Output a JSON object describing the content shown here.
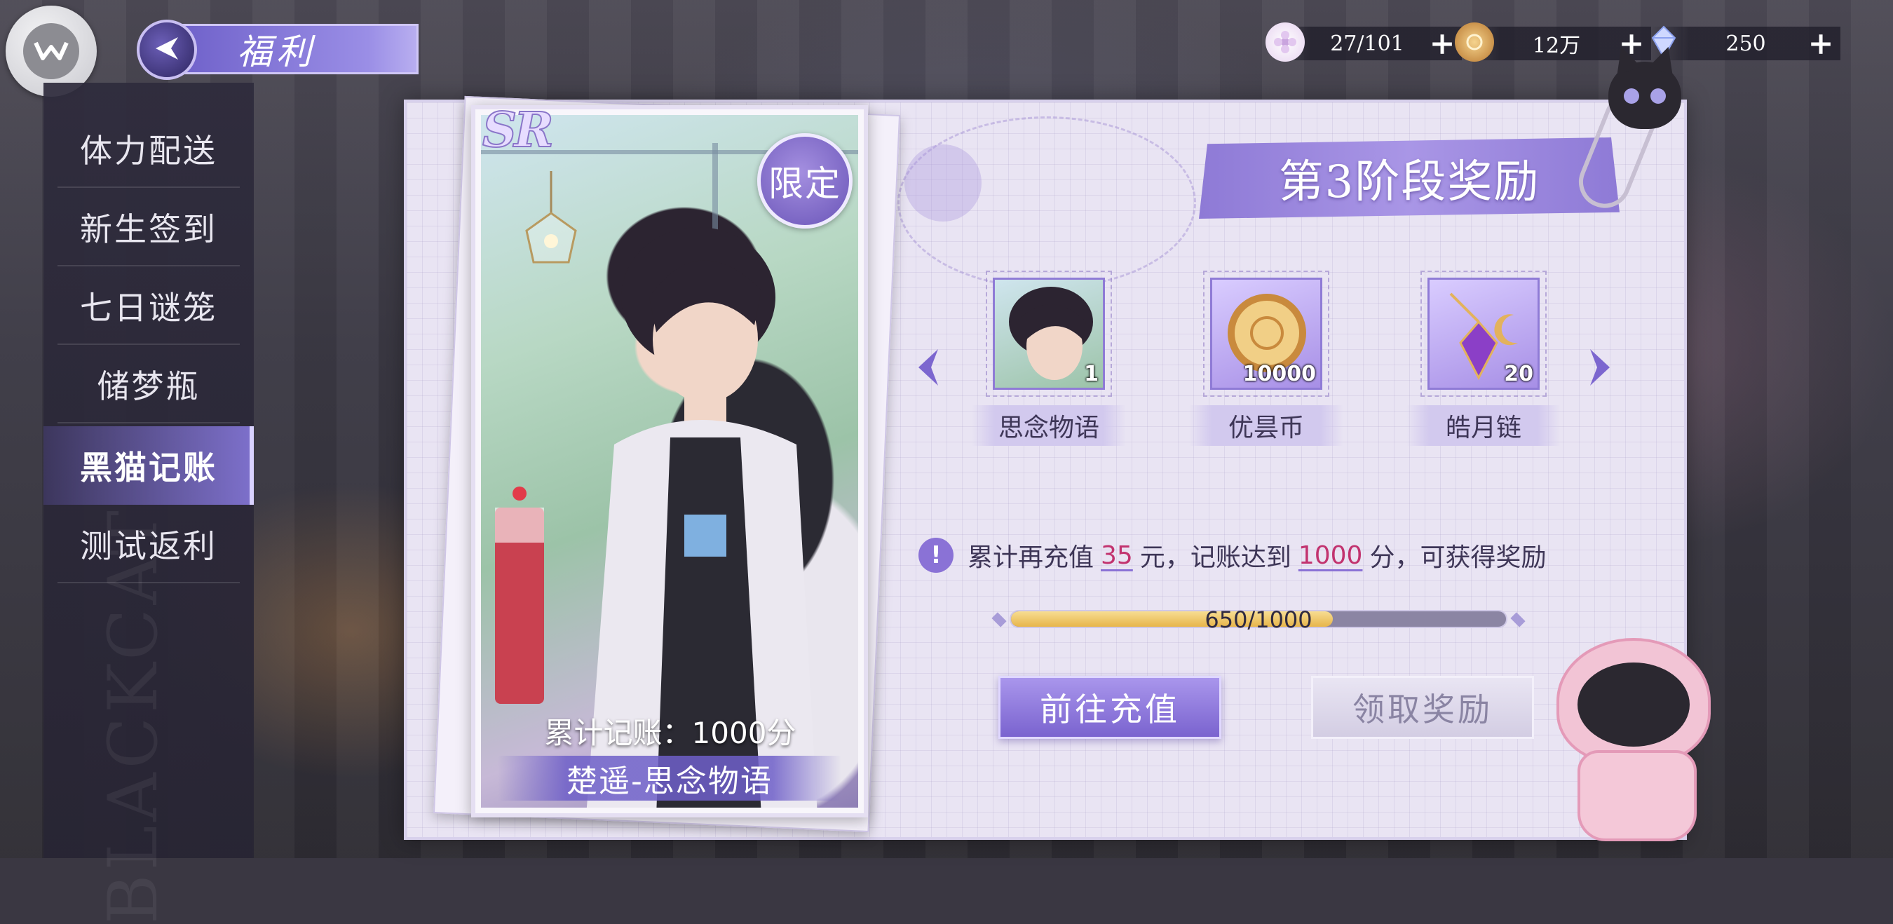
{
  "header": {
    "title": "福利"
  },
  "currencies": [
    {
      "icon": "stamina-flower-icon",
      "value": "27/101"
    },
    {
      "icon": "coin-icon",
      "value": "12万"
    },
    {
      "icon": "crystal-icon",
      "value": "250"
    }
  ],
  "sidebar": {
    "items": [
      {
        "label": "体力配送",
        "active": false
      },
      {
        "label": "新生签到",
        "active": false
      },
      {
        "label": "七日谜笼",
        "active": false
      },
      {
        "label": "储梦瓶",
        "active": false
      },
      {
        "label": "黑猫记账",
        "active": true
      },
      {
        "label": "测试返利",
        "active": false
      }
    ],
    "bg_text": "BLACKCAT"
  },
  "card": {
    "rarity": "SR",
    "limited": "限定",
    "caption": "累计记账：1000分",
    "name": "楚遥-思念物语"
  },
  "stage": {
    "title": "第3阶段奖励"
  },
  "rewards": [
    {
      "label": "思念物语",
      "count": "1",
      "icon": "character-portrait-icon"
    },
    {
      "label": "优昙币",
      "count": "10000",
      "icon": "coin-icon"
    },
    {
      "label": "皓月链",
      "count": "20",
      "icon": "moon-pendant-icon"
    }
  ],
  "requirement": {
    "prefix": "累计再充值",
    "amount": "35",
    "mid": "元，记账达到",
    "points": "1000",
    "suffix": "分，可获得奖励"
  },
  "progress": {
    "current": 650,
    "total": 1000,
    "text": "650/1000"
  },
  "buttons": {
    "go_recharge": "前往充值",
    "claim": "领取奖励"
  },
  "colors": {
    "accent": "#8a72d6",
    "highlight": "#c2336f",
    "progress_fill": "#e7b54a"
  }
}
